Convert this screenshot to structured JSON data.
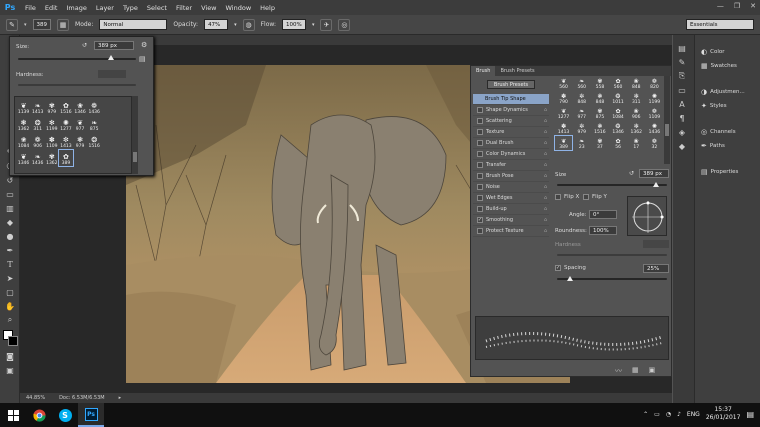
{
  "app": {
    "logo": "Ps"
  },
  "menu": [
    "File",
    "Edit",
    "Image",
    "Layer",
    "Type",
    "Select",
    "Filter",
    "View",
    "Window",
    "Help"
  ],
  "window_controls": [
    "minimize-icon",
    "maximize-icon",
    "close-icon"
  ],
  "options_bar": {
    "brush_size": "389",
    "mode_label": "Mode:",
    "mode_value": "Normal",
    "opacity_label": "Opacity:",
    "opacity_value": "47%",
    "flow_label": "Flow:",
    "flow_value": "100%",
    "workspace": "Essentials"
  },
  "brush_picker": {
    "size_label": "Size:",
    "size_value": "389 px",
    "hardness_label": "Hardness:",
    "brushes": [
      {
        "n": "1139"
      },
      {
        "n": "1413"
      },
      {
        "n": "979"
      },
      {
        "n": "1516"
      },
      {
        "n": "1346"
      },
      {
        "n": "1436"
      },
      {
        "n": ""
      },
      {
        "n": ""
      },
      {
        "n": "1362"
      },
      {
        "n": "311"
      },
      {
        "n": "1199"
      },
      {
        "n": "1277"
      },
      {
        "n": "977"
      },
      {
        "n": "875"
      },
      {
        "n": ""
      },
      {
        "n": ""
      },
      {
        "n": "1084"
      },
      {
        "n": "906"
      },
      {
        "n": "1109"
      },
      {
        "n": "1413"
      },
      {
        "n": "979"
      },
      {
        "n": "1516"
      },
      {
        "n": ""
      },
      {
        "n": ""
      },
      {
        "n": "1346"
      },
      {
        "n": "1436"
      },
      {
        "n": "1362"
      },
      {
        "n": "389"
      },
      {
        "n": ""
      },
      {
        "n": ""
      },
      {
        "n": ""
      },
      {
        "n": ""
      }
    ],
    "selected_index": 27
  },
  "brush_panel": {
    "tabs": [
      "Brush",
      "Brush Presets"
    ],
    "presets_button": "Brush Presets",
    "items": [
      {
        "label": "Brush Tip Shape",
        "head": true,
        "checked": false
      },
      {
        "label": "Shape Dynamics",
        "checked": false
      },
      {
        "label": "Scattering",
        "checked": false
      },
      {
        "label": "Texture",
        "checked": false
      },
      {
        "label": "Dual Brush",
        "checked": false
      },
      {
        "label": "Color Dynamics",
        "checked": false
      },
      {
        "label": "Transfer",
        "checked": false
      },
      {
        "label": "Brush Pose",
        "checked": false
      },
      {
        "label": "Noise",
        "checked": false
      },
      {
        "label": "Wet Edges",
        "checked": false
      },
      {
        "label": "Build-up",
        "checked": false
      },
      {
        "label": "Smoothing",
        "checked": true
      },
      {
        "label": "Protect Texture",
        "checked": false
      }
    ],
    "tips": [
      "560",
      "560",
      "558",
      "560",
      "848",
      "820",
      "790",
      "848",
      "848",
      "1011",
      "311",
      "1199",
      "1277",
      "977",
      "875",
      "1084",
      "906",
      "1109",
      "1413",
      "979",
      "1516",
      "1346",
      "1362",
      "1436",
      "389",
      "23",
      "37",
      "56",
      "17",
      "32"
    ],
    "selected_tip_index": 24,
    "size_label": "Size",
    "size_value": "389 px",
    "flipx_label": "Flip X",
    "flipy_label": "Flip Y",
    "angle_label": "Angle:",
    "angle_value": "0°",
    "roundness_label": "Roundness:",
    "roundness_value": "100%",
    "hardness_label": "Hardness",
    "spacing_label": "Spacing",
    "spacing_value": "25%",
    "spacing_checked": true
  },
  "right_dock": {
    "entries": [
      {
        "label": "Color",
        "icon": "color-icon"
      },
      {
        "label": "Swatches",
        "icon": "swatches-icon"
      },
      {
        "label": "Adjustmen...",
        "icon": "adjustments-icon"
      },
      {
        "label": "Styles",
        "icon": "styles-icon"
      },
      {
        "label": "Channels",
        "icon": "channels-icon"
      },
      {
        "label": "Paths",
        "icon": "paths-icon"
      },
      {
        "label": "Properties",
        "icon": "properties-icon"
      }
    ]
  },
  "status": {
    "zoom": "44.85%",
    "doc": "Doc: 6.53M/6.53M"
  },
  "taskbar": {
    "language": "ENG",
    "time": "15:37",
    "date": "26/01/2017"
  }
}
